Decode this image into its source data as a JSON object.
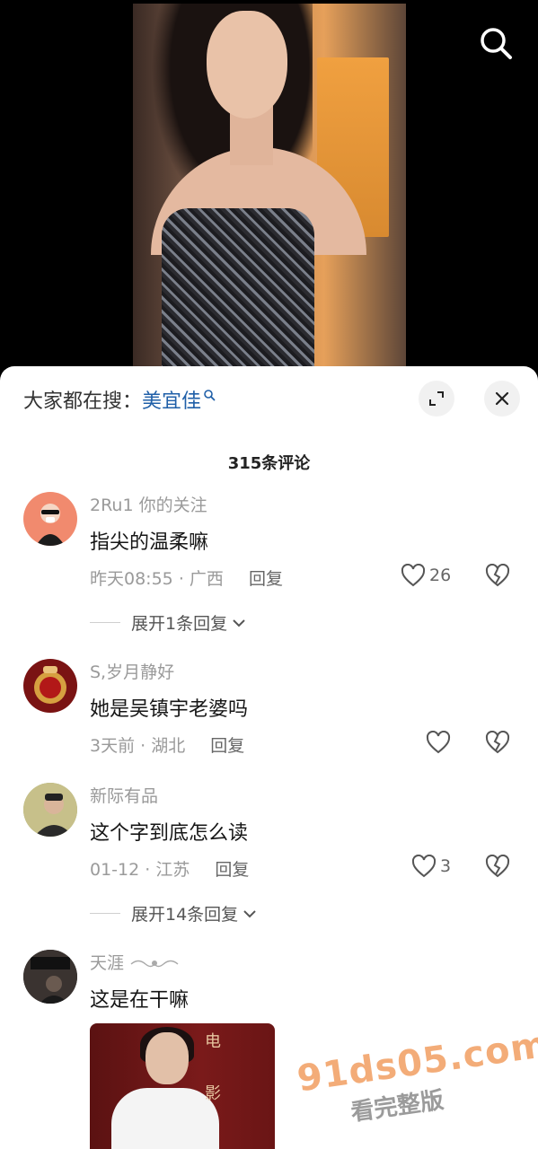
{
  "icons": {
    "top_search": "search-icon",
    "expand": "expand-icon",
    "close": "close-icon",
    "like": "heart-icon",
    "dislike": "broken-heart-icon",
    "chevron": "chevron-down-icon"
  },
  "search_suggest": {
    "prefix": "大家都在搜：",
    "keyword": "美宜佳"
  },
  "comments_header": {
    "count_title": "315条评论"
  },
  "comments": [
    {
      "username": "2Ru1 你的关注",
      "text": "指尖的温柔嘛",
      "time": "昨天08:55",
      "location": "广西",
      "reply_label": "回复",
      "likes": "26",
      "expand_label": "展开1条回复"
    },
    {
      "username": "S,岁月静好",
      "text": "她是吴镇宇老婆吗",
      "time": "3天前",
      "location": "湖北",
      "reply_label": "回复",
      "likes": ""
    },
    {
      "username": "新际有品",
      "text": "这个字到底怎么读",
      "time": "01-12",
      "location": "江苏",
      "reply_label": "回复",
      "likes": "3",
      "expand_label": "展开14条回复"
    },
    {
      "username": "天涯",
      "text": "这是在干嘛",
      "image_glyphs": [
        "电",
        "影"
      ]
    }
  ],
  "watermark": {
    "site": "91ds05.com",
    "tagline": "看完整版"
  },
  "colors": {
    "keyword": "#1f5fa8",
    "sheet_bg": "#ffffff",
    "meta_text": "#9a9a9a"
  }
}
